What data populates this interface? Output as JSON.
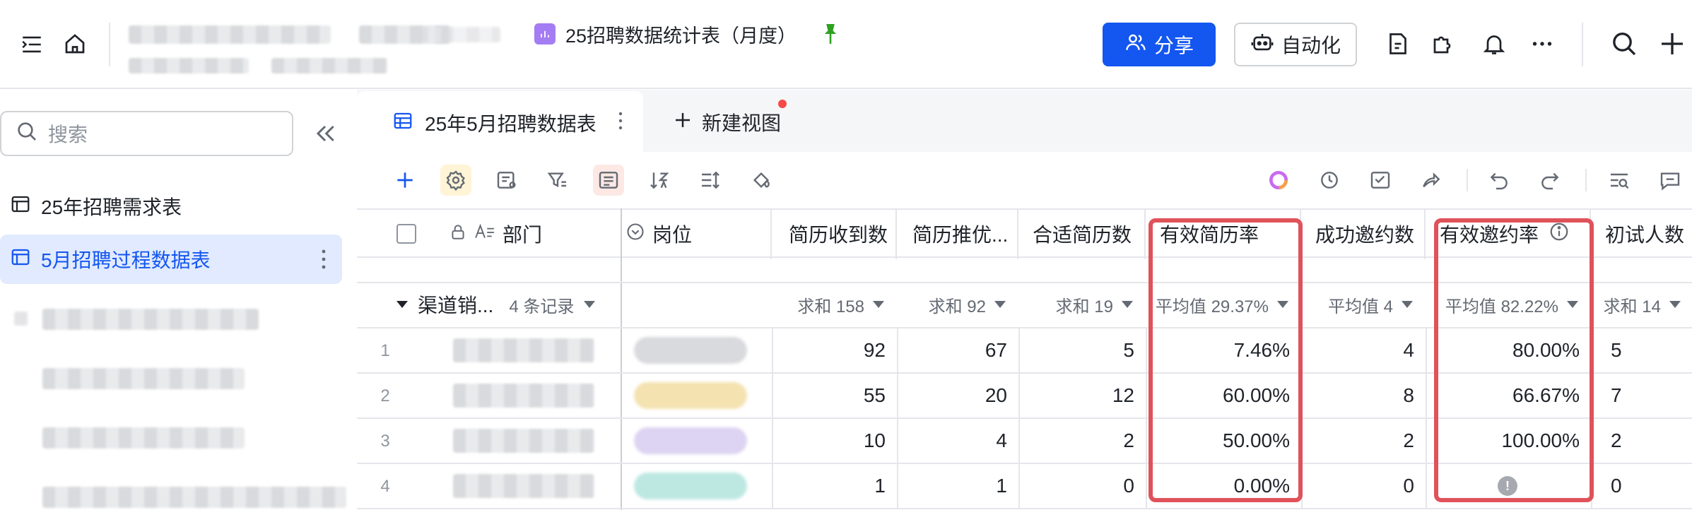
{
  "header": {
    "doc_title": "25招聘数据统计表（月度）",
    "share_label": "分享",
    "automation_label": "自动化",
    "icons": [
      "sidebar-toggle-icon",
      "home-icon",
      "pin-icon",
      "file-icon",
      "plugin-icon",
      "bell-icon",
      "more-icon",
      "search-icon",
      "plus-icon"
    ]
  },
  "sidebar": {
    "search_placeholder": "搜索",
    "items": [
      {
        "label": "25年招聘需求表",
        "active": false
      },
      {
        "label": "5月招聘过程数据表",
        "active": true
      }
    ]
  },
  "views": {
    "active_tab": "25年5月招聘数据表",
    "new_view_label": "新建视图"
  },
  "table": {
    "columns": [
      "部门",
      "岗位",
      "简历收到数",
      "简历推优...",
      "合适简历数",
      "有效简历率",
      "成功邀约数",
      "有效邀约率",
      "初试人数"
    ],
    "group": {
      "name": "渠道销...",
      "count": "4 条记录",
      "summaries": [
        "求和 158",
        "求和 92",
        "求和 19",
        "平均值 29.37%",
        "平均值 4",
        "平均值 82.22%",
        "求和 14"
      ]
    },
    "rows": [
      {
        "num": "1",
        "values": [
          "92",
          "67",
          "5",
          "7.46%",
          "4",
          "80.00%",
          "5"
        ]
      },
      {
        "num": "2",
        "values": [
          "55",
          "20",
          "12",
          "60.00%",
          "8",
          "66.67%",
          "7"
        ]
      },
      {
        "num": "3",
        "values": [
          "10",
          "4",
          "2",
          "50.00%",
          "2",
          "100.00%",
          "2"
        ]
      },
      {
        "num": "4",
        "values": [
          "1",
          "1",
          "0",
          "0.00%",
          "0",
          "",
          "0"
        ]
      }
    ]
  },
  "colors": {
    "accent": "#1456f0",
    "highlight_box": "#e0525a"
  }
}
